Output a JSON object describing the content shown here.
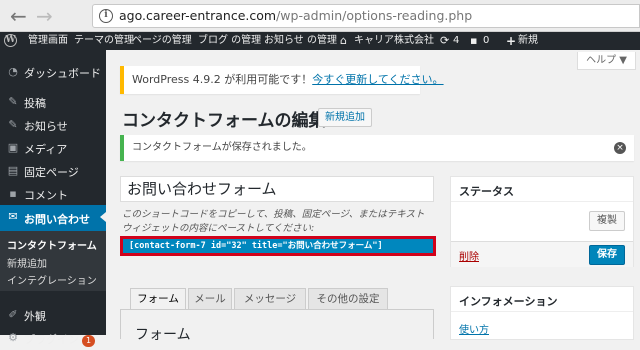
{
  "browser": {
    "back_arrow": "←",
    "forward_arrow": "→",
    "url_host": "ago.career-entrance.com",
    "url_path": "/wp-admin/options-reading.php"
  },
  "adminbar": {
    "items": [
      "管理画面",
      "テーマの管理",
      "ページの管理",
      "ブログ の管理",
      "お知らせ の管理"
    ],
    "site_name": "キャリア株式会社",
    "updates_count": "4",
    "comments_count": "0",
    "new_label": "新規"
  },
  "sidebar": {
    "items": [
      {
        "label": "ダッシュボード",
        "icon": "dashboard-icon"
      },
      {
        "label": "投稿",
        "icon": "pin-icon"
      },
      {
        "label": "お知らせ",
        "icon": "pin-icon"
      },
      {
        "label": "メディア",
        "icon": "media-icon"
      },
      {
        "label": "固定ページ",
        "icon": "page-icon"
      },
      {
        "label": "コメント",
        "icon": "comment-icon"
      },
      {
        "label": "お問い合わせ",
        "icon": "mail-icon"
      },
      {
        "label": "外観",
        "icon": "brush-icon"
      },
      {
        "label": "プラグイン",
        "icon": "plugin-icon"
      }
    ],
    "submenu": [
      "コンタクトフォーム",
      "新規追加",
      "インテグレーション"
    ],
    "plugin_badge": "1"
  },
  "help_tab": "ヘルプ ▼",
  "update_nag": {
    "text": "WordPress 4.9.2 が利用可能です！",
    "link": "今すぐ更新してください。"
  },
  "page": {
    "title": "コンタクトフォームの編集",
    "add_new": "新規追加",
    "notice": "コンタクトフォームが保存されました。",
    "form_title": "お問い合わせフォーム",
    "hint": "このショートコードをコピーして、投稿、固定ページ、またはテキストウィジェットの内容にペーストしてください:",
    "shortcode": "[contact-form-7 id=\"32\" title=\"お問い合わせフォーム\"]"
  },
  "tabs": [
    "フォーム",
    "メール",
    "メッセージ",
    "その他の設定"
  ],
  "panel_title": "フォーム",
  "status_box": {
    "title": "ステータス",
    "duplicate": "複製",
    "delete": "削除",
    "save": "保存"
  },
  "info_box": {
    "title": "インフォメーション",
    "link": "使い方"
  },
  "colors": {
    "admin_bar": "#23282d",
    "active_menu": "#0073aa",
    "shortcode_bg": "#0087be",
    "highlight_border": "#d0021b",
    "notice_green": "#46b450",
    "nag_yellow": "#ffb900"
  }
}
